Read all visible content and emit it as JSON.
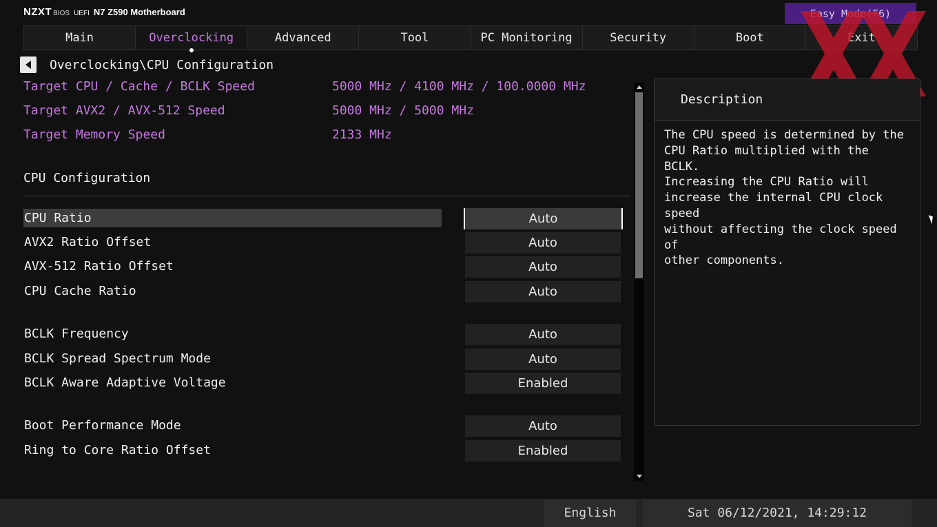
{
  "brand": {
    "logo": "NZXT",
    "bios": "BIOS",
    "uefi": "UEFI",
    "model": "N7 Z590 Motherboard"
  },
  "easy_mode": {
    "label": "Easy Mode(F6)"
  },
  "tabs": [
    {
      "label": "Main"
    },
    {
      "label": "Overclocking",
      "active": true
    },
    {
      "label": "Advanced"
    },
    {
      "label": "Tool"
    },
    {
      "label": "PC Monitoring"
    },
    {
      "label": "Security"
    },
    {
      "label": "Boot"
    },
    {
      "label": "Exit"
    }
  ],
  "breadcrumb": "Overclocking\\CPU Configuration",
  "info": [
    {
      "label": "Target CPU / Cache / BCLK Speed",
      "value": "5000 MHz / 4100 MHz / 100.0000 MHz"
    },
    {
      "label": "Target AVX2 / AVX-512 Speed",
      "value": "5000 MHz / 5000 MHz"
    },
    {
      "label": "Target Memory Speed",
      "value": "2133 MHz"
    }
  ],
  "section_title": "CPU Configuration",
  "options": [
    {
      "label": "CPU  Ratio",
      "value": "Auto",
      "selected": true
    },
    {
      "label": "AVX2 Ratio Offset",
      "value": "Auto"
    },
    {
      "label": "AVX-512 Ratio Offset",
      "value": "Auto"
    },
    {
      "label": "CPU  Cache Ratio",
      "value": "Auto"
    },
    {
      "label": "BCLK Frequency",
      "value": "Auto"
    },
    {
      "label": "BCLK Spread Spectrum Mode",
      "value": "Auto"
    },
    {
      "label": "BCLK Aware Adaptive Voltage",
      "value": "Enabled"
    },
    {
      "label": "Boot Performance Mode",
      "value": "Auto"
    },
    {
      "label": "Ring to Core Ratio Offset",
      "value": "Enabled"
    }
  ],
  "description": {
    "title": "Description",
    "text": "The CPU speed is determined by the\nCPU Ratio multiplied with the BCLK.\nIncreasing the CPU Ratio will\nincrease the internal CPU clock speed\nwithout affecting the clock speed of\nother components."
  },
  "footer": {
    "language": "English",
    "datetime": "Sat 06/12/2021, 14:29:12"
  },
  "colors": {
    "accent": "#c678e0",
    "easy_mode_bg": "#4b1e82",
    "watermark": "#c0162a"
  },
  "icons": {
    "back": "back-arrow-icon",
    "watermark": "xx-watermark-icon"
  }
}
